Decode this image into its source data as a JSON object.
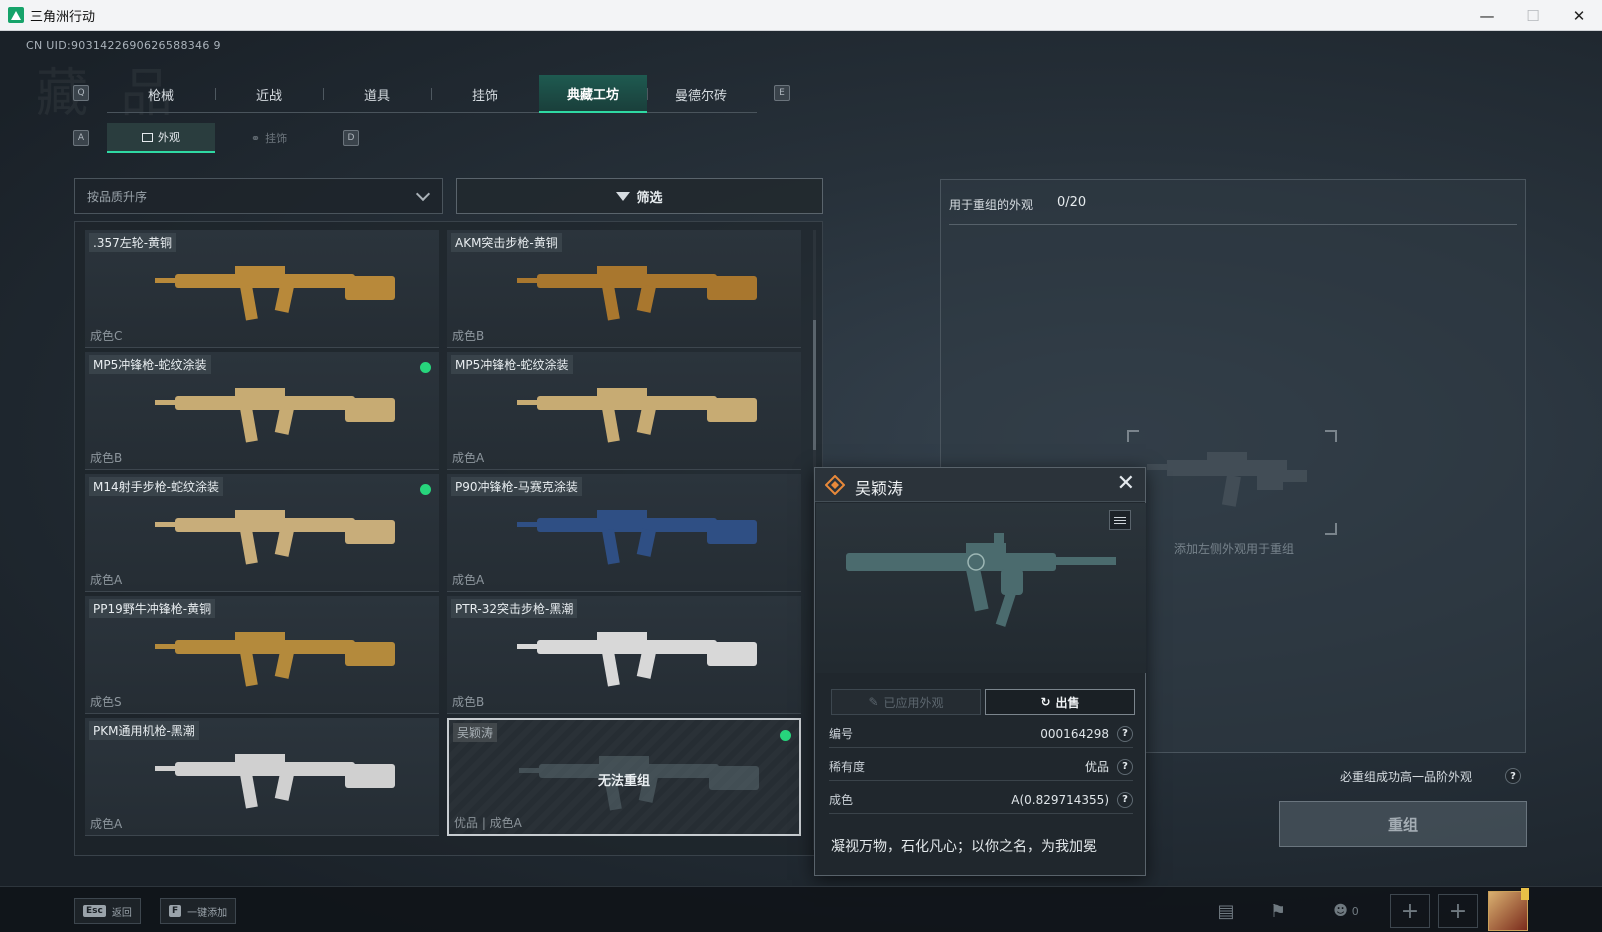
{
  "window": {
    "title": "三角洲行动"
  },
  "uid": "CN UID:9031422690626588346 9",
  "nav": {
    "prev_key": "Q",
    "next_key": "E",
    "tabs": [
      {
        "label": "枪械"
      },
      {
        "label": "近战"
      },
      {
        "label": "道具"
      },
      {
        "label": "挂饰"
      },
      {
        "label": "典藏工坊",
        "active": true
      },
      {
        "label": "曼德尔砖"
      }
    ]
  },
  "subnav": {
    "prev_key": "A",
    "next_key": "D",
    "tabs": [
      {
        "label": "外观",
        "active": true
      },
      {
        "label": "挂饰"
      }
    ]
  },
  "sort": {
    "value": "按品质升序"
  },
  "filter": {
    "label": "筛选"
  },
  "items": [
    {
      "name": ".357左轮-黄铜",
      "grade": "成色C",
      "equipped": false,
      "color": "#b8893a"
    },
    {
      "name": "AKM突击步枪-黄铜",
      "grade": "成色B",
      "equipped": false,
      "color": "#a9772e"
    },
    {
      "name": "MP5冲锋枪-蛇纹涂装",
      "grade": "成色B",
      "equipped": true,
      "color": "#c7ab73"
    },
    {
      "name": "MP5冲锋枪-蛇纹涂装",
      "grade": "成色A",
      "equipped": false,
      "color": "#c7ab73"
    },
    {
      "name": "M14射手步枪-蛇纹涂装",
      "grade": "成色A",
      "equipped": true,
      "color": "#c8ad7a"
    },
    {
      "name": "P90冲锋枪-马赛克涂装",
      "grade": "成色A",
      "equipped": false,
      "color": "#2f4f84"
    },
    {
      "name": "PP19野牛冲锋枪-黄铜",
      "grade": "成色S",
      "equipped": false,
      "color": "#b48a3c"
    },
    {
      "name": "PTR-32突击步枪-黑潮",
      "grade": "成色B",
      "equipped": false,
      "color": "#d8d8d8"
    },
    {
      "name": "PKM通用机枪-黑潮",
      "grade": "成色A",
      "equipped": false,
      "color": "#d0d0d0"
    },
    {
      "name": "吴颖涛",
      "grade": "优品 | 成色A",
      "equipped": true,
      "locked": true,
      "lock_text": "无法重组",
      "color": "#5a6a70"
    }
  ],
  "reform_panel": {
    "title": "用于重组的外观",
    "count": "0/20",
    "placeholder": "添加左侧外观用于重组",
    "guarantee": "必重组成功高一品阶外观",
    "button": "重组"
  },
  "detail": {
    "title": "吴颖涛",
    "close": "✕",
    "applied_label": "已应用外观",
    "sell_label": "出售",
    "rows": [
      {
        "key": "编号",
        "value": "000164298"
      },
      {
        "key": "稀有度",
        "value": "优品"
      },
      {
        "key": "成色",
        "value": "A(0.829714355)"
      }
    ],
    "motto": "凝视万物，石化凡心；以你之名，为我加冕",
    "gun_color": "#4b6b6e",
    "rarity_color": "#e8893a"
  },
  "bottom": {
    "back_key": "Esc",
    "back_label": "返回",
    "add_key": "F",
    "add_label": "一键添加",
    "friends_count": "0"
  }
}
